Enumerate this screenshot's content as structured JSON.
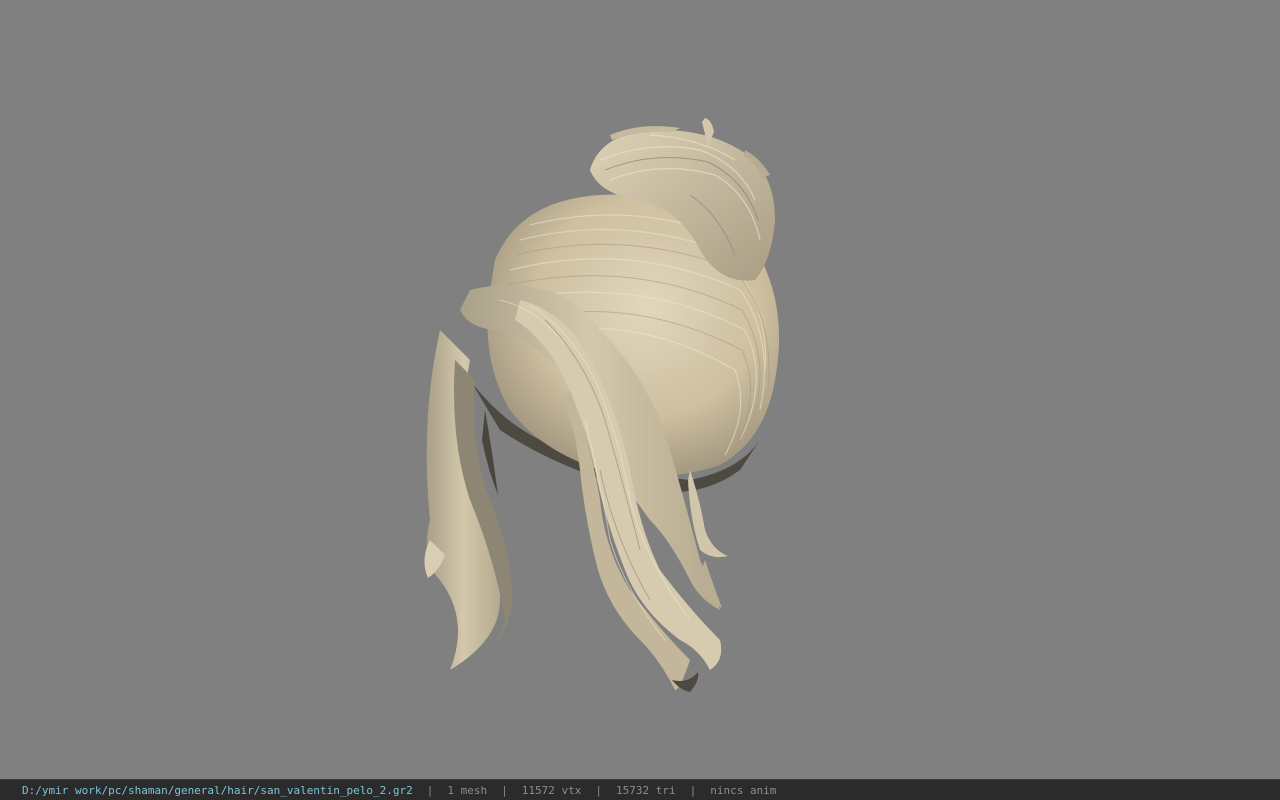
{
  "viewer": {
    "background_color": "#808080",
    "model_subject": "hair-mesh",
    "hair_color": "#cbbd9e"
  },
  "status_bar": {
    "file_path": "D:/ymir work/pc/shaman/general/hair/san_valentin_pelo_2.gr2",
    "separator": "|",
    "mesh_count": "1 mesh",
    "vertex_count": "11572 vtx",
    "triangle_count": "15732 tri",
    "animation": "nincs anim"
  }
}
